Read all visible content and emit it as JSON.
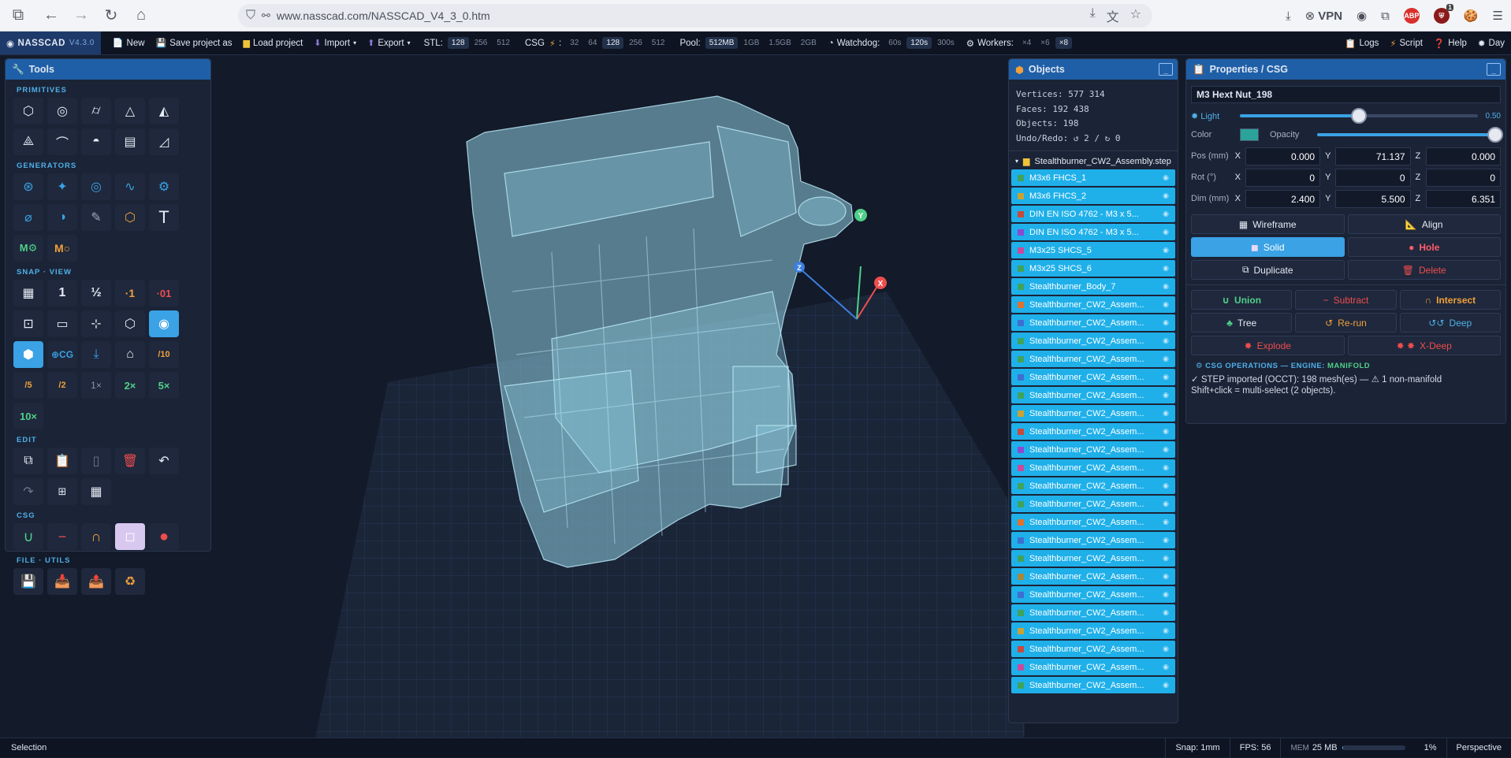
{
  "browser": {
    "url": "www.nasscad.com/NASSCAD_V4_3_0.htm",
    "vpn_label": "VPN",
    "ext_badge": "1"
  },
  "toolbar": {
    "logo": "NASSCAD",
    "version": "V4.3.0",
    "new": "New",
    "save": "Save project as",
    "load": "Load project",
    "import": "Import",
    "export": "Export",
    "stl_label": "STL:",
    "stl_options": [
      "128",
      "256",
      "512"
    ],
    "csg_label": "CSG",
    "csg_options": [
      "32",
      "64",
      "128",
      "256",
      "512"
    ],
    "pool_label": "Pool:",
    "pool_options": [
      "512MB",
      "1GB",
      "1.5GB",
      "2GB"
    ],
    "watchdog_label": "Watchdog:",
    "watchdog_options": [
      "60s",
      "120s",
      "300s"
    ],
    "workers_label": "Workers:",
    "workers_options": [
      "×4",
      "×6",
      "×8"
    ],
    "logs": "Logs",
    "script": "Script",
    "help": "Help",
    "day": "Day"
  },
  "tools": {
    "title": "Tools",
    "sections": {
      "primitives": "PRIMITIVES",
      "generators": "GENERATORS",
      "snap": "SNAP · VIEW",
      "edit": "EDIT",
      "csg": "CSG",
      "file": "FILE · UTILS"
    },
    "snap_labels": [
      "1",
      "½",
      "·1",
      "·01",
      "/10",
      "/5",
      "/2",
      "1×",
      "2×",
      "5×",
      "10×",
      "⊕CG"
    ],
    "gen_labels": [
      "T",
      "M⚙",
      "M○"
    ]
  },
  "objects": {
    "title": "Objects",
    "stats": {
      "vertices": "Vertices: 577 314",
      "faces": "Faces: 192 438",
      "objects": "Objects: 198",
      "undo": "Undo/Redo: ↺ 2 / ↻ 0"
    },
    "root": "Stealthburner_CW2_Assembly.step",
    "items": [
      {
        "name": "M3x6 FHCS_1",
        "color": "#3fa35c"
      },
      {
        "name": "M3x6 FHCS_2",
        "color": "#c9a234"
      },
      {
        "name": "DIN EN ISO 4762 - M3 x 5...",
        "color": "#c94a3d"
      },
      {
        "name": "DIN EN ISO 4762 - M3 x 5...",
        "color": "#8a4ad1"
      },
      {
        "name": "M3x25 SHCS_5",
        "color": "#c94a9b"
      },
      {
        "name": "M3x25 SHCS_6",
        "color": "#3fa35c"
      },
      {
        "name": "Stealthburner_Body_7",
        "color": "#3fa35c"
      },
      {
        "name": "Stealthburner_CW2_Assem...",
        "color": "#e0722f"
      },
      {
        "name": "Stealthburner_CW2_Assem...",
        "color": "#3d6fd1"
      },
      {
        "name": "Stealthburner_CW2_Assem...",
        "color": "#3fa35c"
      },
      {
        "name": "Stealthburner_CW2_Assem...",
        "color": "#3fa35c"
      },
      {
        "name": "Stealthburner_CW2_Assem...",
        "color": "#3d6fd1"
      },
      {
        "name": "Stealthburner_CW2_Assem...",
        "color": "#3fa35c"
      },
      {
        "name": "Stealthburner_CW2_Assem...",
        "color": "#c9a234"
      },
      {
        "name": "Stealthburner_CW2_Assem...",
        "color": "#c94a3d"
      },
      {
        "name": "Stealthburner_CW2_Assem...",
        "color": "#8a4ad1"
      },
      {
        "name": "Stealthburner_CW2_Assem...",
        "color": "#c94a9b"
      },
      {
        "name": "Stealthburner_CW2_Assem...",
        "color": "#3fa35c"
      },
      {
        "name": "Stealthburner_CW2_Assem...",
        "color": "#3fa35c"
      },
      {
        "name": "Stealthburner_CW2_Assem...",
        "color": "#e0722f"
      },
      {
        "name": "Stealthburner_CW2_Assem...",
        "color": "#3d6fd1"
      },
      {
        "name": "Stealthburner_CW2_Assem...",
        "color": "#3fa35c"
      },
      {
        "name": "Stealthburner_CW2_Assem...",
        "color": "#a9873a"
      },
      {
        "name": "Stealthburner_CW2_Assem...",
        "color": "#3d6fd1"
      },
      {
        "name": "Stealthburner_CW2_Assem...",
        "color": "#3fa35c"
      },
      {
        "name": "Stealthburner_CW2_Assem...",
        "color": "#c9a234"
      },
      {
        "name": "Stealthburner_CW2_Assem...",
        "color": "#c94a3d"
      },
      {
        "name": "Stealthburner_CW2_Assem...",
        "color": "#c94a9b"
      },
      {
        "name": "Stealthburner_CW2_Assem...",
        "color": "#3fa35c"
      }
    ]
  },
  "properties": {
    "title": "Properties / CSG",
    "name": "M3 Hext Nut_198",
    "light_label": "Light",
    "light_value": "0.50",
    "light_level": 0.5,
    "color_label": "Color",
    "color_value": "#2ba39a",
    "opacity_label": "Opacity",
    "opacity_level": 1.0,
    "pos_label": "Pos (mm)",
    "rot_label": "Rot (°)",
    "dim_label": "Dim (mm)",
    "axes": [
      "X",
      "Y",
      "Z"
    ],
    "pos": [
      "0.000",
      "71.137",
      "0.000"
    ],
    "rot": [
      "0",
      "0",
      "0"
    ],
    "dim": [
      "2.400",
      "5.500",
      "6.351"
    ],
    "wireframe": "Wireframe",
    "align": "Align",
    "solid": "Solid",
    "hole": "Hole",
    "duplicate": "Duplicate",
    "delete": "Delete",
    "union": "Union",
    "subtract": "Subtract",
    "intersect": "Intersect",
    "tree": "Tree",
    "rerun": "Re-run",
    "deep": "Deep",
    "explode": "Explode",
    "xdeep": "X-Deep",
    "csg_header": "CSG OPERATIONS — ENGINE:",
    "engine": "MANIFOLD",
    "log1": "✓ STEP imported (OCCT): 198 mesh(es) — ⚠ 1 non-manifold",
    "log2": "Shift+click = multi-select (2 objects)."
  },
  "status": {
    "mode": "Selection",
    "snap": "Snap: 1mm",
    "fps": "FPS: 56",
    "mem_label": "MEM",
    "mem_value": "25 MB",
    "mem_level": 0.01,
    "mem_pct": "1%",
    "projection": "Perspective"
  },
  "viewport": {
    "axis_x": "X",
    "axis_y": "Y",
    "axis_z": "Z"
  }
}
